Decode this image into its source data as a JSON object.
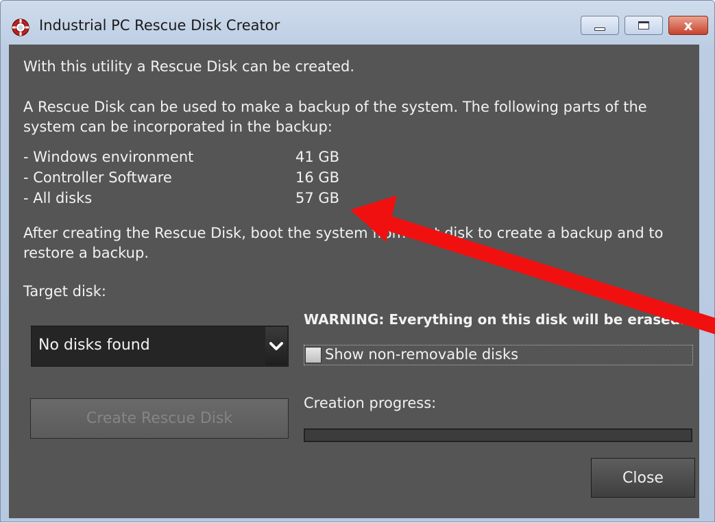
{
  "window": {
    "title": "Industrial PC Rescue Disk Creator",
    "icon": "lifebuoy-icon",
    "controls": [
      "minimize",
      "maximize",
      "close"
    ],
    "close_glyph": "x"
  },
  "intro": {
    "line1": "With this utility a Rescue Disk can be created.",
    "line2a": "A Rescue Disk can be used to make a backup of the system.  The following parts of the",
    "line2b": "system can be incorporated in the backup:"
  },
  "parts": [
    {
      "label": "- Windows environment",
      "size": "41 GB"
    },
    {
      "label": "- Controller Software",
      "size": "16 GB"
    },
    {
      "label": "- All disks",
      "size": "57 GB"
    }
  ],
  "after": {
    "line1_start": "After creating the Rescue Disk, boot the system from ",
    "line1_obscured": "that",
    "line1_end": " disk to create a backup and to",
    "line2": "restore a backup."
  },
  "target": {
    "label": "Target disk:",
    "selected": "No disks found"
  },
  "warning": "WARNING:  Everything on this disk will be erased.",
  "checkbox": {
    "label": "Show non-removable disks",
    "checked": false
  },
  "create_button": {
    "label": "Create Rescue Disk",
    "enabled": false
  },
  "progress": {
    "label": "Creation progress:",
    "value": 0
  },
  "close_button": {
    "label": "Close"
  },
  "colors": {
    "client_bg": "#555555",
    "text": "#f2f2f2",
    "annotation_arrow": "#f01010",
    "disabled_text": "#858585"
  }
}
